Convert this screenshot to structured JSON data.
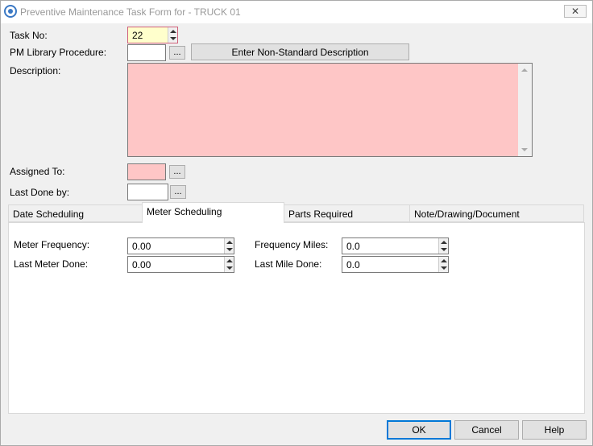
{
  "window": {
    "title": "Preventive Maintenance Task Form for - TRUCK 01",
    "close_symbol": "✕"
  },
  "form": {
    "task_no_label": "Task No:",
    "task_no_value": "22",
    "pm_library_label": "PM Library Procedure:",
    "pm_library_value": "",
    "browse_label": "...",
    "non_standard_button": "Enter Non-Standard Description",
    "description_label": "Description:",
    "description_value": "",
    "assigned_to_label": "Assigned To:",
    "assigned_to_value": "",
    "last_done_by_label": "Last Done by:",
    "last_done_by_value": ""
  },
  "tabs": [
    {
      "label": "Date Scheduling",
      "active": false
    },
    {
      "label": "Meter Scheduling",
      "active": true
    },
    {
      "label": "Parts Required",
      "active": false
    },
    {
      "label": "Note/Drawing/Document",
      "active": false
    }
  ],
  "meter": {
    "meter_frequency_label": "Meter Frequency:",
    "meter_frequency_value": "0.00",
    "last_meter_done_label": "Last Meter Done:",
    "last_meter_done_value": "0.00",
    "frequency_miles_label": "Frequency Miles:",
    "frequency_miles_value": "0.0",
    "last_mile_done_label": "Last Mile Done:",
    "last_mile_done_value": "0.0"
  },
  "buttons": {
    "ok": "OK",
    "cancel": "Cancel",
    "help": "Help"
  },
  "colors": {
    "required_field": "#fec6c6",
    "active_field": "#ffffcc",
    "default_button_border": "#0078d7"
  }
}
